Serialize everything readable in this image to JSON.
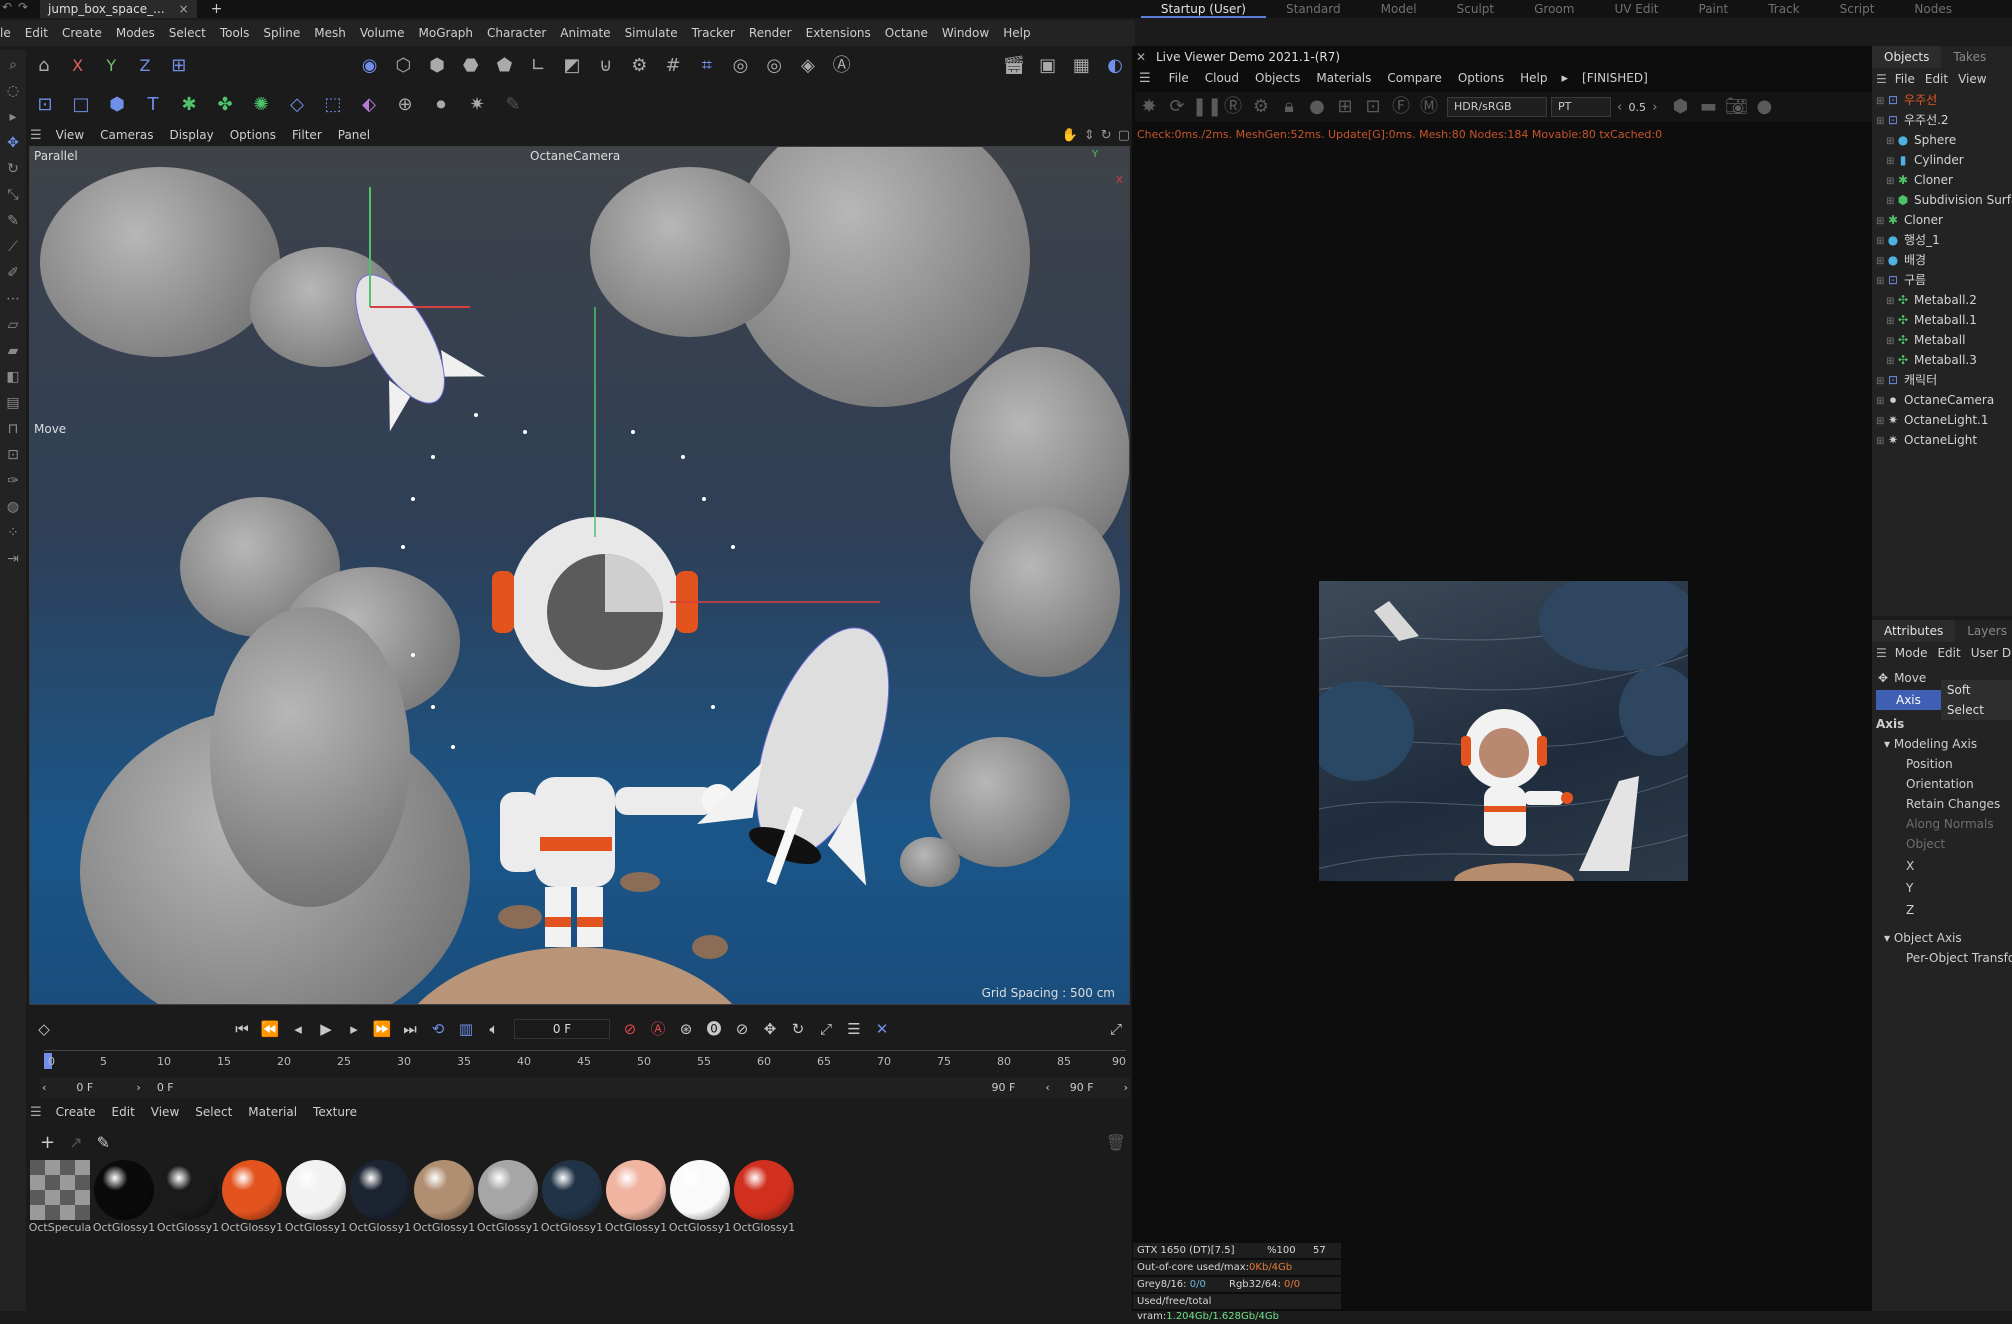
{
  "titlebar": {
    "tab_name": "jump_box_space_...",
    "close": "×",
    "add": "+"
  },
  "layouts": [
    "Startup (User)",
    "Standard",
    "Model",
    "Sculpt",
    "Groom",
    "UV Edit",
    "Paint",
    "Track",
    "Script",
    "Nodes"
  ],
  "menu": [
    "le",
    "Edit",
    "Create",
    "Modes",
    "Select",
    "Tools",
    "Spline",
    "Mesh",
    "Volume",
    "MoGraph",
    "Character",
    "Animate",
    "Simulate",
    "Tracker",
    "Render",
    "Extensions",
    "Octane",
    "Window",
    "Help"
  ],
  "axis_buttons": [
    "X",
    "Y",
    "Z"
  ],
  "viewport": {
    "menu": [
      "View",
      "Cameras",
      "Display",
      "Options",
      "Filter",
      "Panel"
    ],
    "projection": "Parallel",
    "camera": "OctaneCamera",
    "tool": "Move",
    "grid_spacing": "Grid Spacing : 500 cm",
    "axis_x": "X",
    "axis_y": "Y"
  },
  "timeline": {
    "frame_field": "0 F",
    "ticks": [
      "0",
      "5",
      "10",
      "15",
      "20",
      "25",
      "30",
      "35",
      "40",
      "45",
      "50",
      "55",
      "60",
      "65",
      "70",
      "75",
      "80",
      "85",
      "90"
    ],
    "range_start": "0 F",
    "range_cur": "0 F",
    "range_end": "90 F",
    "range_end2": "90 F"
  },
  "material_manager": {
    "menu": [
      "Create",
      "Edit",
      "View",
      "Select",
      "Material",
      "Texture"
    ],
    "materials": [
      {
        "label": "OctSpecula",
        "color": "#cfcfcf"
      },
      {
        "label": "OctGlossy1",
        "color": "#0a0a0a"
      },
      {
        "label": "OctGlossy1",
        "color": "#1a1a1a"
      },
      {
        "label": "OctGlossy1",
        "color": "#e2531d"
      },
      {
        "label": "OctGlossy1",
        "color": "#f2f2f2"
      },
      {
        "label": "OctGlossy1",
        "color": "#1c2432"
      },
      {
        "label": "OctGlossy1",
        "color": "#b08e71"
      },
      {
        "label": "OctGlossy1",
        "color": "#a6a6a6"
      },
      {
        "label": "OctGlossy1",
        "color": "#213347"
      },
      {
        "label": "OctGlossy1",
        "color": "#f0b4a1"
      },
      {
        "label": "OctGlossy1",
        "color": "#fafafa"
      },
      {
        "label": "OctGlossy1",
        "color": "#d1301e"
      }
    ]
  },
  "live_viewer": {
    "title": "Live Viewer Demo 2021.1-(R7)",
    "menu": [
      "File",
      "Cloud",
      "Objects",
      "Materials",
      "Compare",
      "Options",
      "Help"
    ],
    "state": "[FINISHED]",
    "color_space": "HDR/sRGB",
    "kernel": "PT",
    "value": "0.5",
    "status": "Check:0ms./2ms. MeshGen:52ms. Update[G]:0ms. Mesh:80 Nodes:184 Movable:80 txCached:0",
    "gpu": {
      "row1": [
        "GTX 1650 (DT)[7.5]",
        "%100",
        "57"
      ],
      "row2_label": "Out-of-core used/max:",
      "row2_value": "0Kb/4Gb",
      "row3_label1": "Grey8/16:",
      "row3_value1": "0/0",
      "row3_label2": "Rgb32/64:",
      "row3_value2": "0/0",
      "row4_label": "Used/free/total vram:",
      "row4_value": "1.204Gb/1.628Gb/4Gb"
    }
  },
  "objects_panel": {
    "tabs": [
      "Objects",
      "Takes"
    ],
    "menu": [
      "File",
      "Edit",
      "View"
    ],
    "items": [
      {
        "name": "우주선",
        "indent": 0,
        "color": "#e05a1e",
        "icon": "null"
      },
      {
        "name": "우주선.2",
        "indent": 0,
        "color": "#d4d4d4",
        "icon": "null"
      },
      {
        "name": "Sphere",
        "indent": 1,
        "color": "#d4d4d4",
        "icon": "sphere"
      },
      {
        "name": "Cylinder",
        "indent": 1,
        "color": "#d4d4d4",
        "icon": "cylinder"
      },
      {
        "name": "Cloner",
        "indent": 1,
        "color": "#d4d4d4",
        "icon": "cloner"
      },
      {
        "name": "Subdivision Surface",
        "indent": 1,
        "color": "#d4d4d4",
        "icon": "subdiv"
      },
      {
        "name": "Cloner",
        "indent": 0,
        "color": "#d4d4d4",
        "icon": "cloner"
      },
      {
        "name": "행성_1",
        "indent": 0,
        "color": "#d4d4d4",
        "icon": "sphere"
      },
      {
        "name": "배경",
        "indent": 0,
        "color": "#d4d4d4",
        "icon": "sphere"
      },
      {
        "name": "구름",
        "indent": 0,
        "color": "#d4d4d4",
        "icon": "null"
      },
      {
        "name": "Metaball.2",
        "indent": 1,
        "color": "#d4d4d4",
        "icon": "metaball"
      },
      {
        "name": "Metaball.1",
        "indent": 1,
        "color": "#d4d4d4",
        "icon": "metaball"
      },
      {
        "name": "Metaball",
        "indent": 1,
        "color": "#d4d4d4",
        "icon": "metaball"
      },
      {
        "name": "Metaball.3",
        "indent": 1,
        "color": "#d4d4d4",
        "icon": "metaball"
      },
      {
        "name": "캐릭터",
        "indent": 0,
        "color": "#d4d4d4",
        "icon": "null"
      },
      {
        "name": "OctaneCamera",
        "indent": 0,
        "color": "#d4d4d4",
        "icon": "camera"
      },
      {
        "name": "OctaneLight.1",
        "indent": 0,
        "color": "#d4d4d4",
        "icon": "light"
      },
      {
        "name": "OctaneLight",
        "indent": 0,
        "color": "#d4d4d4",
        "icon": "light"
      }
    ]
  },
  "attributes_panel": {
    "tabs": [
      "Attributes",
      "Layers"
    ],
    "menu": [
      "Mode",
      "Edit",
      "User D"
    ],
    "tool": "Move",
    "subtabs": [
      "Axis",
      "Soft Select"
    ],
    "section": "Axis",
    "group1": "Modeling Axis",
    "rows": [
      "Position",
      "Orientation",
      "Retain Changes",
      "Along Normals",
      "Object",
      "X",
      "Y",
      "Z"
    ],
    "group2": "Object Axis",
    "per_object": "Per-Object Transform"
  },
  "colors": {
    "accent": "#5a7fd6",
    "orange": "#e05a1e"
  }
}
